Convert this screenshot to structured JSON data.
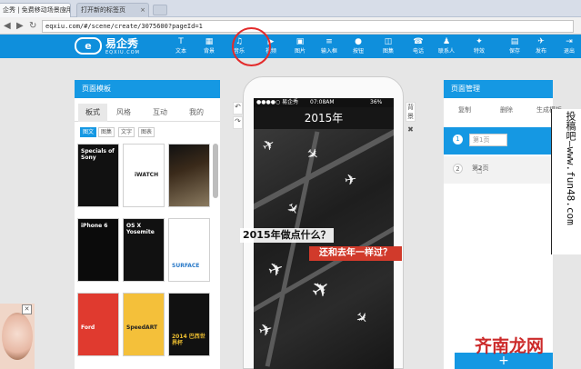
{
  "browser": {
    "tabs": [
      {
        "label": "企秀 | 免费移动场景应用"
      },
      {
        "label": "打开新的标签页"
      }
    ],
    "url": "eqxiu.com/#/scene/create/3075600?pageId=1"
  },
  "toolbar": {
    "logo_name": "易企秀",
    "logo_sub": "EQXIU.COM",
    "items": [
      {
        "icon": "T",
        "label": "文本",
        "icon_name": "text-icon"
      },
      {
        "icon": "▦",
        "label": "背景",
        "icon_name": "background-icon"
      },
      {
        "icon": "♫",
        "label": "音乐",
        "icon_name": "music-icon"
      },
      {
        "icon": "▶",
        "label": "视频",
        "icon_name": "video-icon"
      },
      {
        "icon": "▣",
        "label": "图片",
        "icon_name": "image-icon"
      },
      {
        "icon": "≡",
        "label": "输入框",
        "icon_name": "input-box-icon"
      },
      {
        "icon": "●",
        "label": "按钮",
        "icon_name": "button-icon"
      },
      {
        "icon": "◫",
        "label": "图集",
        "icon_name": "gallery-icon"
      },
      {
        "icon": "☎",
        "label": "电话",
        "icon_name": "phone-icon"
      },
      {
        "icon": "♟",
        "label": "联系人",
        "icon_name": "contact-icon"
      },
      {
        "icon": "✦",
        "label": "特效",
        "icon_name": "effects-icon"
      },
      {
        "icon": "▤",
        "label": "保存",
        "icon_name": "save-icon"
      },
      {
        "icon": "✈",
        "label": "发布",
        "icon_name": "publish-icon"
      },
      {
        "icon": "⇥",
        "label": "退出",
        "icon_name": "exit-icon"
      }
    ]
  },
  "left_panel": {
    "title": "页面模板",
    "tabs": [
      "板式",
      "风格",
      "互动",
      "我的"
    ],
    "filters": [
      "图文",
      "图集",
      "文字",
      "图表"
    ],
    "templates": [
      "Specials of Sony",
      "iWATCH",
      "",
      "iPhone 6",
      "OS X Yosemite",
      "SURFACE",
      "Ford",
      "SpeedART",
      "2014 巴西世界杯"
    ]
  },
  "phone": {
    "carrier": "●●●●○ 易企秀",
    "time": "07:08AM",
    "battery": "36%",
    "title": "2015年",
    "caption1": "2015年做点什么？",
    "caption2": "还和去年一样过？",
    "side_label": "背景"
  },
  "right_panel": {
    "title": "页面管理",
    "actions": [
      "复制",
      "删除",
      "生成模板"
    ],
    "pages": [
      {
        "num": "1",
        "name": "第1页"
      },
      {
        "num": "2",
        "name": "第2页"
      }
    ]
  },
  "watermark": {
    "vertical_text": "投稿吧—www.fun48.com",
    "logo_text": "齐南龙网"
  },
  "colors": {
    "toolbar": "#0f8fdc",
    "panel_header": "#1598e3",
    "highlight_circle": "#e32b2b",
    "caption_red": "#d13a2b"
  }
}
